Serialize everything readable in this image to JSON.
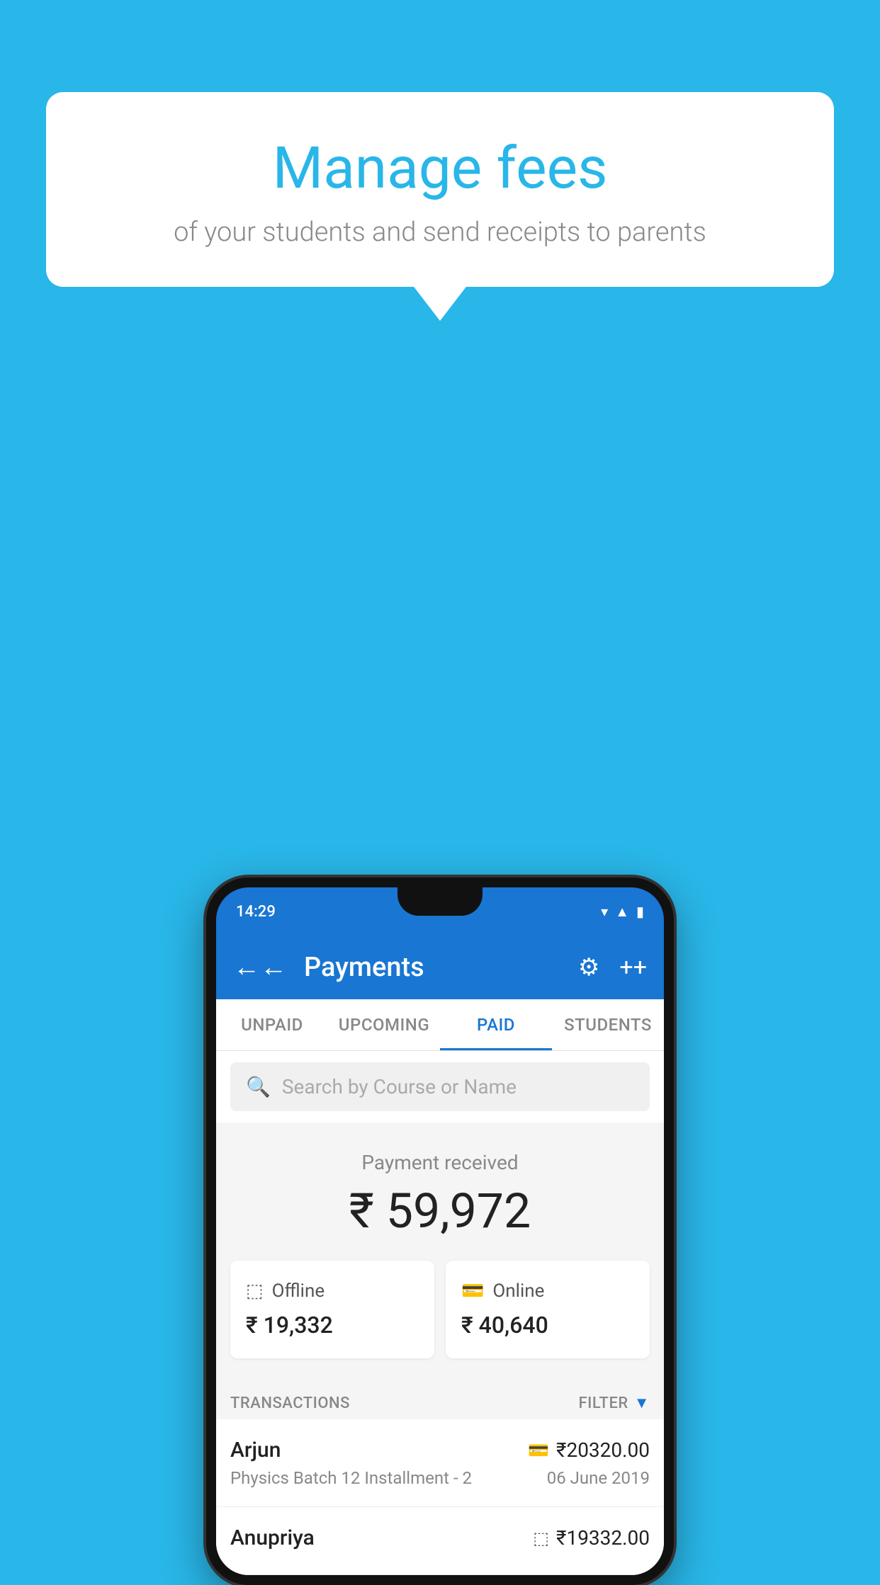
{
  "background_color": "#29B6E8",
  "bubble": {
    "title": "Manage fees",
    "subtitle": "of your students and send receipts to parents"
  },
  "phone": {
    "status_time": "14:29",
    "app_bar": {
      "title": "Payments",
      "back_label": "←",
      "gear_label": "⚙",
      "plus_label": "+"
    },
    "tabs": [
      {
        "label": "UNPAID",
        "active": false
      },
      {
        "label": "UPCOMING",
        "active": false
      },
      {
        "label": "PAID",
        "active": true
      },
      {
        "label": "STUDENTS",
        "active": false
      }
    ],
    "search": {
      "placeholder": "Search by Course or Name"
    },
    "payment_summary": {
      "label": "Payment received",
      "amount": "₹ 59,972",
      "offline_label": "Offline",
      "offline_amount": "₹ 19,332",
      "online_label": "Online",
      "online_amount": "₹ 40,640"
    },
    "transactions": {
      "header_label": "TRANSACTIONS",
      "filter_label": "FILTER",
      "rows": [
        {
          "name": "Arjun",
          "amount": "₹20320.00",
          "course": "Physics Batch 12 Installment - 2",
          "date": "06 June 2019",
          "payment_type": "online"
        },
        {
          "name": "Anupriya",
          "amount": "₹19332.00",
          "course": "",
          "date": "",
          "payment_type": "offline"
        }
      ]
    }
  }
}
